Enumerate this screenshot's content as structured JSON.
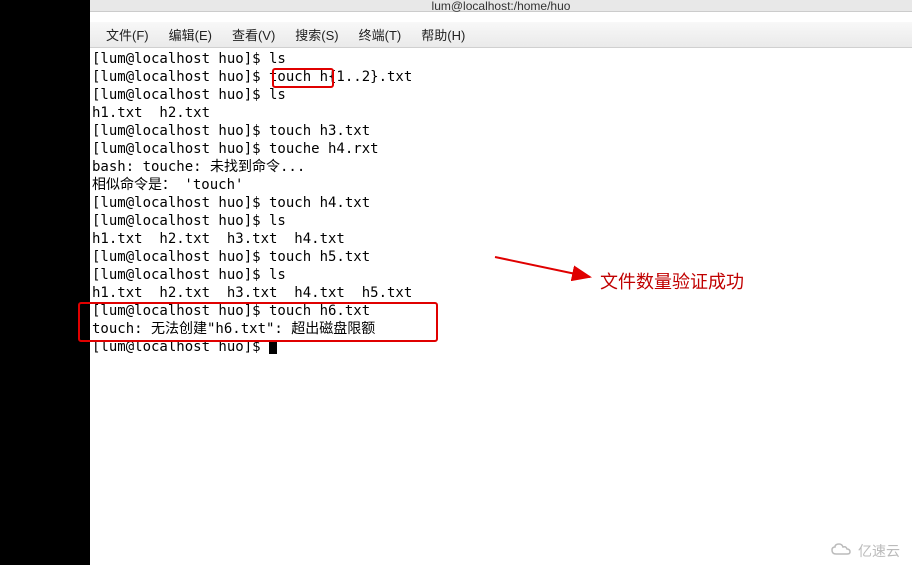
{
  "window": {
    "title": "lum@localhost:/home/huo"
  },
  "menu": {
    "file": "文件(F)",
    "edit": "编辑(E)",
    "view": "查看(V)",
    "search": "搜索(S)",
    "terminal": "终端(T)",
    "help": "帮助(H)"
  },
  "terminal": {
    "lines": [
      "[lum@localhost huo]$ ls",
      "[lum@localhost huo]$ touch h{1..2}.txt",
      "[lum@localhost huo]$ ls",
      "h1.txt  h2.txt",
      "[lum@localhost huo]$ touch h3.txt",
      "[lum@localhost huo]$ touche h4.rxt",
      "bash: touche: 未找到命令...",
      "相似命令是： 'touch'",
      "[lum@localhost huo]$ touch h4.txt",
      "[lum@localhost huo]$ ls",
      "h1.txt  h2.txt  h3.txt  h4.txt",
      "[lum@localhost huo]$ touch h5.txt",
      "[lum@localhost huo]$ ls",
      "h1.txt  h2.txt  h3.txt  h4.txt  h5.txt",
      "[lum@localhost huo]$ touch h6.txt",
      "touch: 无法创建\"h6.txt\": 超出磁盘限额",
      "[lum@localhost huo]$ "
    ]
  },
  "annotation": {
    "text": "文件数量验证成功"
  },
  "watermark": {
    "text": "亿速云"
  }
}
